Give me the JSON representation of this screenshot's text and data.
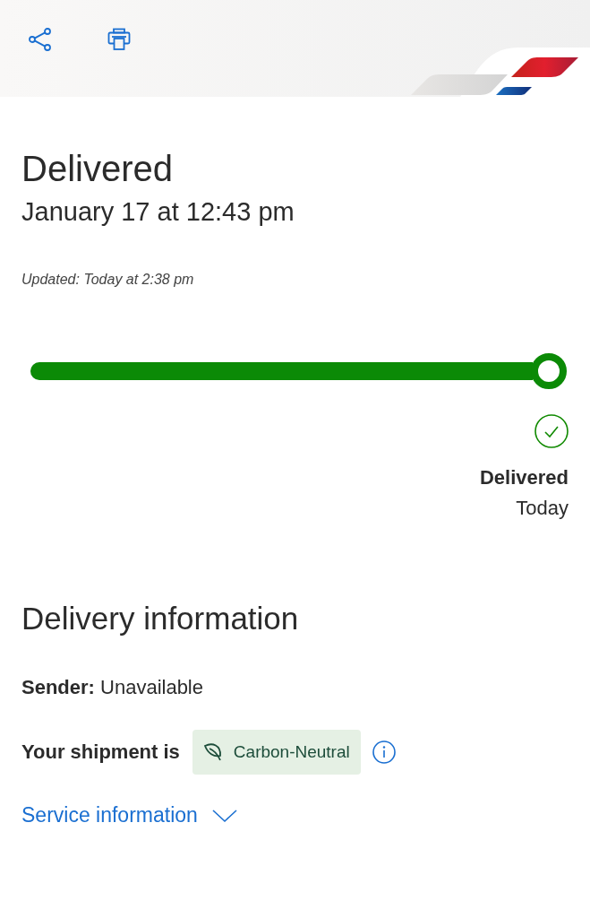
{
  "status": {
    "title": "Delivered",
    "datetime": "January 17 at 12:43 pm",
    "updated": "Updated: Today at 2:38 pm"
  },
  "progress": {
    "level": 1.0,
    "milestone": {
      "label": "Delivered",
      "date": "Today",
      "done": true
    }
  },
  "delivery_information": {
    "heading": "Delivery information",
    "sender": {
      "label": "Sender:",
      "value": "Unavailable"
    },
    "shipment": {
      "label": "Your shipment is",
      "badge": "Carbon-Neutral"
    },
    "service_information": {
      "label": "Service information",
      "expanded": false
    }
  }
}
